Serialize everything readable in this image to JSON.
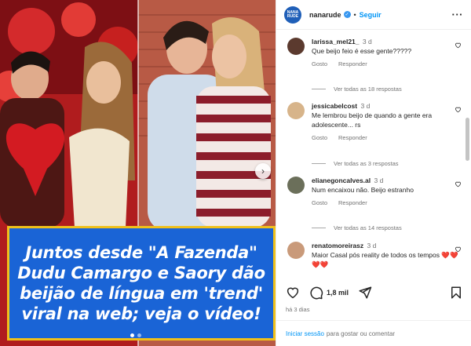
{
  "post": {
    "username": "nanarude",
    "avatar_text": "NANA RUDE",
    "separator": "•",
    "follow_label": "Seguir",
    "more_icon": "more-horizontal-icon",
    "verified_icon": "verified-badge-icon"
  },
  "media": {
    "caption": "Juntos desde \"A Fazenda\" Dudu Camargo e Saory dão beijão de língua em 'trend' viral na web; veja o vídeo!",
    "next_icon": "chevron-right-icon",
    "slide_count": 2,
    "active_slide": 1
  },
  "comments": [
    {
      "user": "larissa_mel21_",
      "time": "3 d",
      "text": "Que beijo feio é esse gente?????",
      "reply": "Responder",
      "likes_label": "Gosto",
      "view_replies": "Ver todas as 18 respostas",
      "avatar_color": "#5b3a2e"
    },
    {
      "user": "jessicabelcost",
      "time": "3 d",
      "text": "Me lembrou beijo de quando a gente era adolescente... rs",
      "reply": "Responder",
      "likes_label": "Gosto",
      "view_replies": "Ver todas as 3 respostas",
      "avatar_color": "#d7b48a"
    },
    {
      "user": "elianegoncalves.al",
      "time": "3 d",
      "text": "Num encaixou não. Beijo estranho",
      "reply": "Responder",
      "likes_label": "Gosto",
      "view_replies": "Ver todas as 14 respostas",
      "avatar_color": "#6b6f5a"
    },
    {
      "user": "renatomoreirasz",
      "time": "3 d",
      "text": "Maior Casal pós reality de todos os tempos ❤️❤️❤️❤️",
      "reply": "",
      "likes_label": "",
      "view_replies": "",
      "avatar_color": "#c99a7a"
    }
  ],
  "actions": {
    "like_icon": "heart-icon",
    "comment_icon": "comment-icon",
    "comment_count": "1,8 mil",
    "share_icon": "share-icon",
    "save_icon": "bookmark-icon"
  },
  "post_time": "há 3 dias",
  "login": {
    "link": "Iniciar sessão",
    "text": "para gostar ou comentar"
  },
  "colors": {
    "accent": "#0095f6",
    "caption_bg": "#1a64d6",
    "caption_border": "#f0c01a",
    "secondary_text": "#737373"
  }
}
